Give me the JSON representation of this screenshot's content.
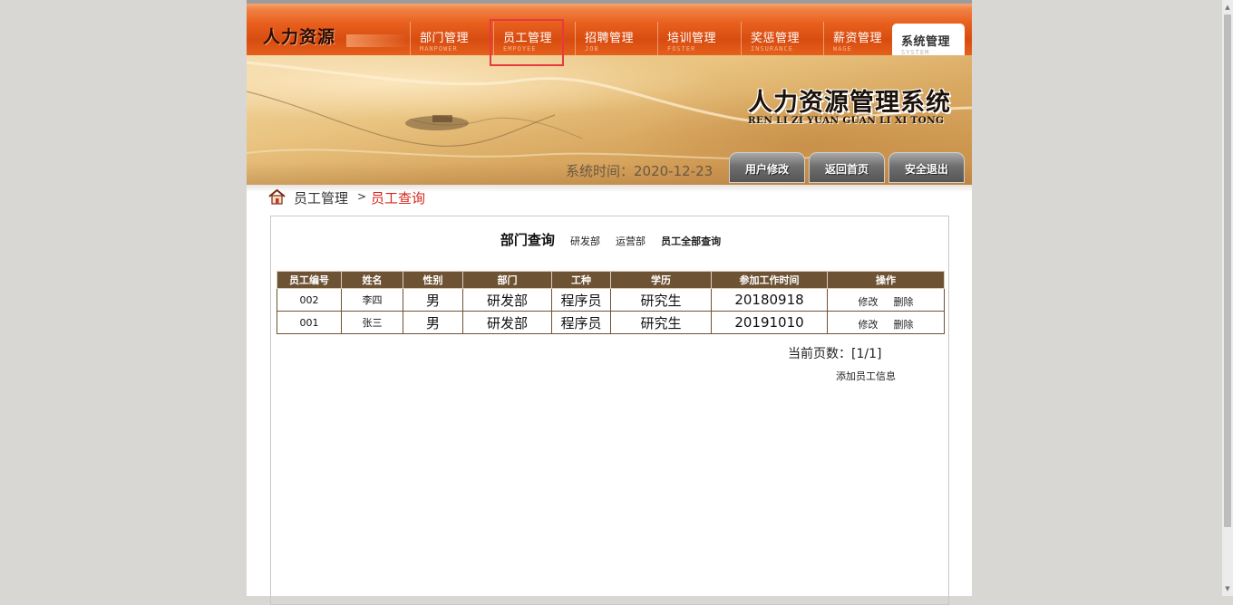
{
  "header": {
    "logo_text": "人力资源",
    "nav": [
      {
        "label": "部门管理",
        "sub": "MANPOWER"
      },
      {
        "label": "员工管理",
        "sub": "EMPOYEE"
      },
      {
        "label": "招聘管理",
        "sub": "JOB"
      },
      {
        "label": "培训管理",
        "sub": "FOSTER"
      },
      {
        "label": "奖惩管理",
        "sub": "INSURANCE"
      },
      {
        "label": "薪资管理",
        "sub": "WAGE"
      },
      {
        "label": "系统管理",
        "sub": "SYSTEM"
      }
    ],
    "active_nav": "系统管理",
    "highlighted_nav": "员工管理"
  },
  "banner": {
    "title": "人力资源管理系统",
    "subtitle": "REN LI ZI YUAN GUAN LI XI TONG",
    "system_time": "系统时间：2020-12-23",
    "buttons": {
      "modify_user": "用户修改",
      "back_home": "返回首页",
      "logout": "安全退出"
    }
  },
  "breadcrumb": {
    "parent": "员工管理",
    "separator": ">",
    "current": "员工查询"
  },
  "query": {
    "title": "部门查询",
    "links": [
      "研发部",
      "运营部"
    ],
    "all_link": "员工全部查询"
  },
  "table": {
    "columns": [
      "员工编号",
      "姓名",
      "性别",
      "部门",
      "工种",
      "学历",
      "参加工作时间",
      "操作"
    ],
    "rows": [
      {
        "id": "002",
        "name": "李四",
        "gender": "男",
        "dept": "研发部",
        "job": "程序员",
        "edu": "研究生",
        "start": "20180918",
        "edit": "修改",
        "delete": "删除"
      },
      {
        "id": "001",
        "name": "张三",
        "gender": "男",
        "dept": "研发部",
        "job": "程序员",
        "edu": "研究生",
        "start": "20191010",
        "edit": "修改",
        "delete": "删除"
      }
    ]
  },
  "pagination": {
    "label": "当前页数：[1/1]"
  },
  "actions": {
    "add_employee": "添加员工信息"
  },
  "colors": {
    "nav_orange": "#e85f1d",
    "table_header": "#6e5234",
    "breadcrumb_current": "#d7261c",
    "highlight_box": "#e8393e"
  }
}
